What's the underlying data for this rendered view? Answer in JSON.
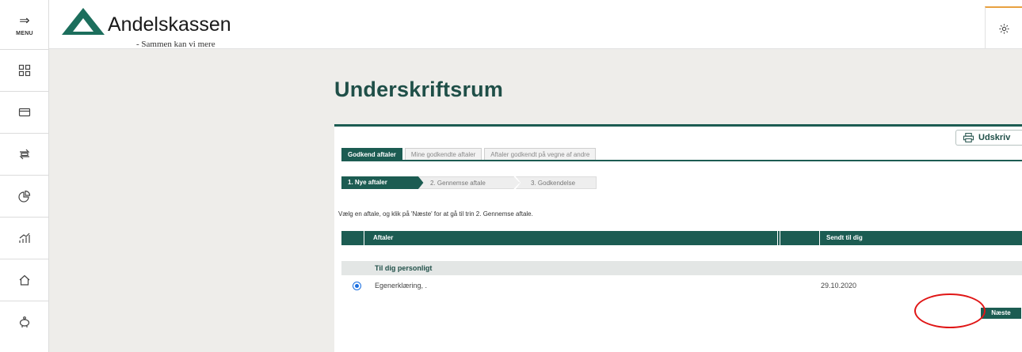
{
  "rail": {
    "menu_label": "MENU",
    "items": [
      {
        "icon": "dashboard-icon"
      },
      {
        "icon": "card-icon"
      },
      {
        "icon": "transfer-icon"
      },
      {
        "icon": "pie-chart-icon"
      },
      {
        "icon": "investment-chart-icon"
      },
      {
        "icon": "home-icon"
      },
      {
        "icon": "piggy-bank-icon"
      }
    ]
  },
  "header": {
    "brand": "Andelskassen",
    "tagline": "- Sammen kan vi mere",
    "settings_icon": "gear-icon"
  },
  "main": {
    "title": "Underskriftsrum",
    "print_label": "Udskriv",
    "tabs": [
      {
        "label": "Godkend aftaler",
        "active": true
      },
      {
        "label": "Mine godkendte aftaler",
        "active": false
      },
      {
        "label": "Aftaler godkendt på vegne af andre",
        "active": false
      }
    ],
    "steps": [
      {
        "label": "1. Nye aftaler",
        "active": true
      },
      {
        "label": "2. Gennemse aftale",
        "active": false
      },
      {
        "label": "3. Godkendelse",
        "active": false
      }
    ],
    "instruction": "Vælg en aftale, og klik på 'Næste' for at gå til trin 2. Gennemse aftale.",
    "table": {
      "headers": [
        "Aftaler",
        "Sendt til dig"
      ],
      "group": "Til dig personligt",
      "rows": [
        {
          "name": "Egenerklæring, .",
          "date": "29.10.2020",
          "selected": true
        }
      ]
    },
    "next_label": "Næste"
  },
  "colors": {
    "primary": "#1c5c52",
    "background": "#eeedea",
    "highlight": "#e01616"
  }
}
